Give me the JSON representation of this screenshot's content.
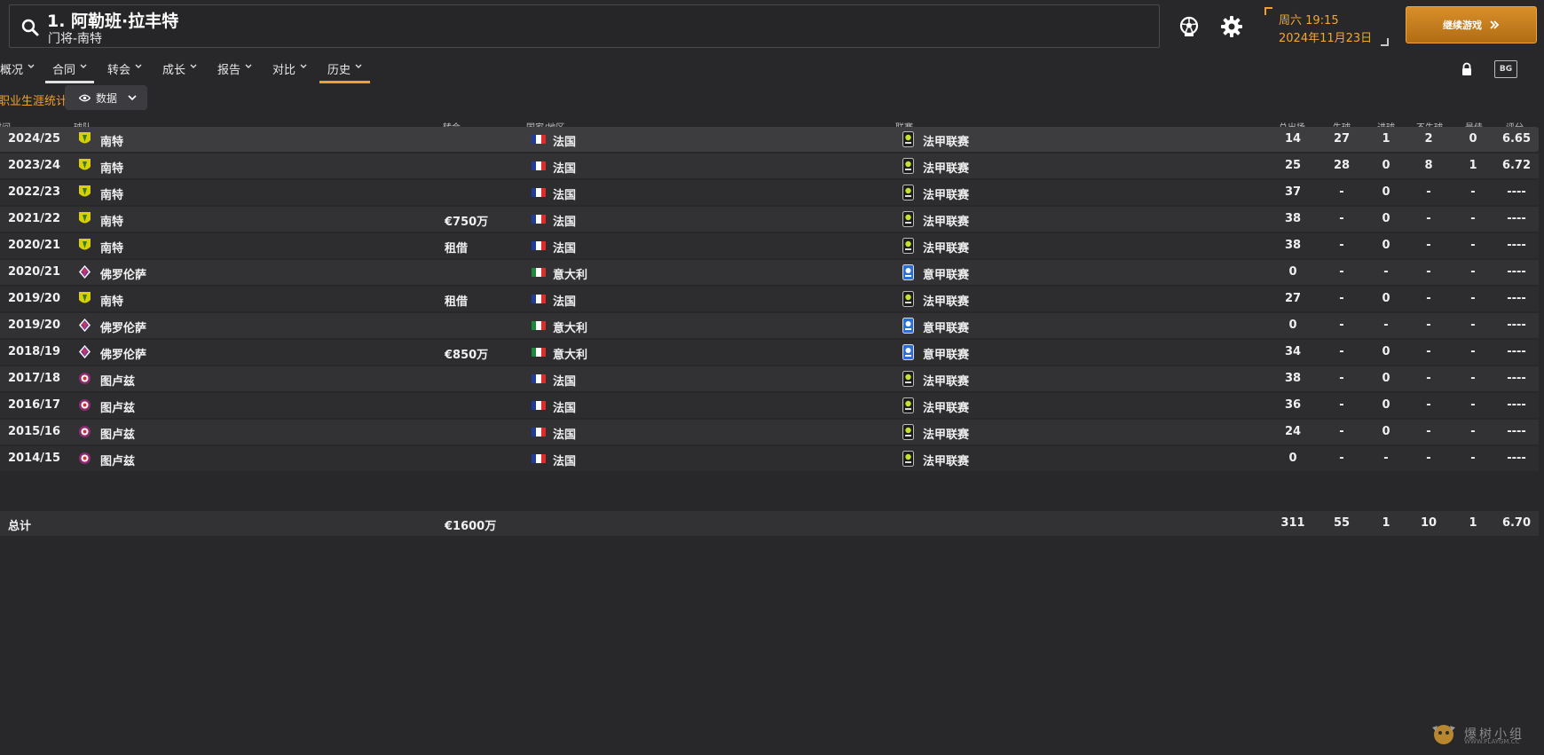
{
  "header": {
    "player_name": "1. 阿勒班·拉丰特",
    "player_subtitle": "门将-南特",
    "date_line1": "周六 19:15",
    "date_line2": "2024年11月23日",
    "continue_label": "继续游戏"
  },
  "tabs": [
    {
      "label": "概况"
    },
    {
      "label": "合同"
    },
    {
      "label": "转会"
    },
    {
      "label": "成长"
    },
    {
      "label": "报告"
    },
    {
      "label": "对比"
    },
    {
      "label": "历史"
    }
  ],
  "toolbar": {
    "bg_label": "BG"
  },
  "section": {
    "title": "职业生涯统计",
    "view_label": "数据"
  },
  "columns": {
    "season": "时间",
    "team": "球队",
    "transfer": "转会",
    "nation": "国家/地区",
    "league": "联赛",
    "apps": "总出场",
    "conceded": "失球",
    "goals": "进球",
    "clean_sheets": "不失球",
    "pom": "最佳",
    "rating": "评分"
  },
  "rows": [
    {
      "season": "2024/25",
      "team": "南特",
      "club_icon": "nantes-crest-icon",
      "transfer": "",
      "nation": "法国",
      "flag": "france-flag-icon",
      "league": "法甲联赛",
      "league_icon": "ligue1-icon",
      "apps": "14",
      "conceded": "27",
      "goals": "1",
      "clean_sheets": "2",
      "pom": "0",
      "rating": "6.65"
    },
    {
      "season": "2023/24",
      "team": "南特",
      "club_icon": "nantes-crest-icon",
      "transfer": "",
      "nation": "法国",
      "flag": "france-flag-icon",
      "league": "法甲联赛",
      "league_icon": "ligue1-icon",
      "apps": "25",
      "conceded": "28",
      "goals": "0",
      "clean_sheets": "8",
      "pom": "1",
      "rating": "6.72"
    },
    {
      "season": "2022/23",
      "team": "南特",
      "club_icon": "nantes-crest-icon",
      "transfer": "",
      "nation": "法国",
      "flag": "france-flag-icon",
      "league": "法甲联赛",
      "league_icon": "ligue1-icon",
      "apps": "37",
      "conceded": "-",
      "goals": "0",
      "clean_sheets": "-",
      "pom": "-",
      "rating": "----"
    },
    {
      "season": "2021/22",
      "team": "南特",
      "club_icon": "nantes-crest-icon",
      "transfer": "€750万",
      "nation": "法国",
      "flag": "france-flag-icon",
      "league": "法甲联赛",
      "league_icon": "ligue1-icon",
      "apps": "38",
      "conceded": "-",
      "goals": "0",
      "clean_sheets": "-",
      "pom": "-",
      "rating": "----"
    },
    {
      "season": "2020/21",
      "team": "南特",
      "club_icon": "nantes-crest-icon",
      "transfer": "租借",
      "nation": "法国",
      "flag": "france-flag-icon",
      "league": "法甲联赛",
      "league_icon": "ligue1-icon",
      "apps": "38",
      "conceded": "-",
      "goals": "0",
      "clean_sheets": "-",
      "pom": "-",
      "rating": "----"
    },
    {
      "season": "2020/21",
      "team": "佛罗伦萨",
      "club_icon": "fiorentina-crest-icon",
      "transfer": "",
      "nation": "意大利",
      "flag": "italy-flag-icon",
      "league": "意甲联赛",
      "league_icon": "serie-a-icon",
      "apps": "0",
      "conceded": "-",
      "goals": "-",
      "clean_sheets": "-",
      "pom": "-",
      "rating": "----"
    },
    {
      "season": "2019/20",
      "team": "南特",
      "club_icon": "nantes-crest-icon",
      "transfer": "租借",
      "nation": "法国",
      "flag": "france-flag-icon",
      "league": "法甲联赛",
      "league_icon": "ligue1-icon",
      "apps": "27",
      "conceded": "-",
      "goals": "0",
      "clean_sheets": "-",
      "pom": "-",
      "rating": "----"
    },
    {
      "season": "2019/20",
      "team": "佛罗伦萨",
      "club_icon": "fiorentina-crest-icon",
      "transfer": "",
      "nation": "意大利",
      "flag": "italy-flag-icon",
      "league": "意甲联赛",
      "league_icon": "serie-a-icon",
      "apps": "0",
      "conceded": "-",
      "goals": "-",
      "clean_sheets": "-",
      "pom": "-",
      "rating": "----"
    },
    {
      "season": "2018/19",
      "team": "佛罗伦萨",
      "club_icon": "fiorentina-crest-icon",
      "transfer": "€850万",
      "nation": "意大利",
      "flag": "italy-flag-icon",
      "league": "意甲联赛",
      "league_icon": "serie-a-icon",
      "apps": "34",
      "conceded": "-",
      "goals": "0",
      "clean_sheets": "-",
      "pom": "-",
      "rating": "----"
    },
    {
      "season": "2017/18",
      "team": "图卢兹",
      "club_icon": "toulouse-crest-icon",
      "transfer": "",
      "nation": "法国",
      "flag": "france-flag-icon",
      "league": "法甲联赛",
      "league_icon": "ligue1-icon",
      "apps": "38",
      "conceded": "-",
      "goals": "0",
      "clean_sheets": "-",
      "pom": "-",
      "rating": "----"
    },
    {
      "season": "2016/17",
      "team": "图卢兹",
      "club_icon": "toulouse-crest-icon",
      "transfer": "",
      "nation": "法国",
      "flag": "france-flag-icon",
      "league": "法甲联赛",
      "league_icon": "ligue1-icon",
      "apps": "36",
      "conceded": "-",
      "goals": "0",
      "clean_sheets": "-",
      "pom": "-",
      "rating": "----"
    },
    {
      "season": "2015/16",
      "team": "图卢兹",
      "club_icon": "toulouse-crest-icon",
      "transfer": "",
      "nation": "法国",
      "flag": "france-flag-icon",
      "league": "法甲联赛",
      "league_icon": "ligue1-icon",
      "apps": "24",
      "conceded": "-",
      "goals": "0",
      "clean_sheets": "-",
      "pom": "-",
      "rating": "----"
    },
    {
      "season": "2014/15",
      "team": "图卢兹",
      "club_icon": "toulouse-crest-icon",
      "transfer": "",
      "nation": "法国",
      "flag": "france-flag-icon",
      "league": "法甲联赛",
      "league_icon": "ligue1-icon",
      "apps": "0",
      "conceded": "-",
      "goals": "-",
      "clean_sheets": "-",
      "pom": "-",
      "rating": "----"
    }
  ],
  "totals": {
    "label": "总计",
    "transfer": "€1600万",
    "apps": "311",
    "conceded": "55",
    "goals": "1",
    "clean_sheets": "10",
    "pom": "1",
    "rating": "6.70"
  },
  "watermark": {
    "text": "爆树小组",
    "url": "WWW.PLAYGM.CC"
  },
  "colors": {
    "accent": "#f0a030",
    "background": "#28282a",
    "nantes": "#d8d000",
    "fiorentina": "#7a3aa0",
    "toulouse": "#8f2a6f"
  }
}
